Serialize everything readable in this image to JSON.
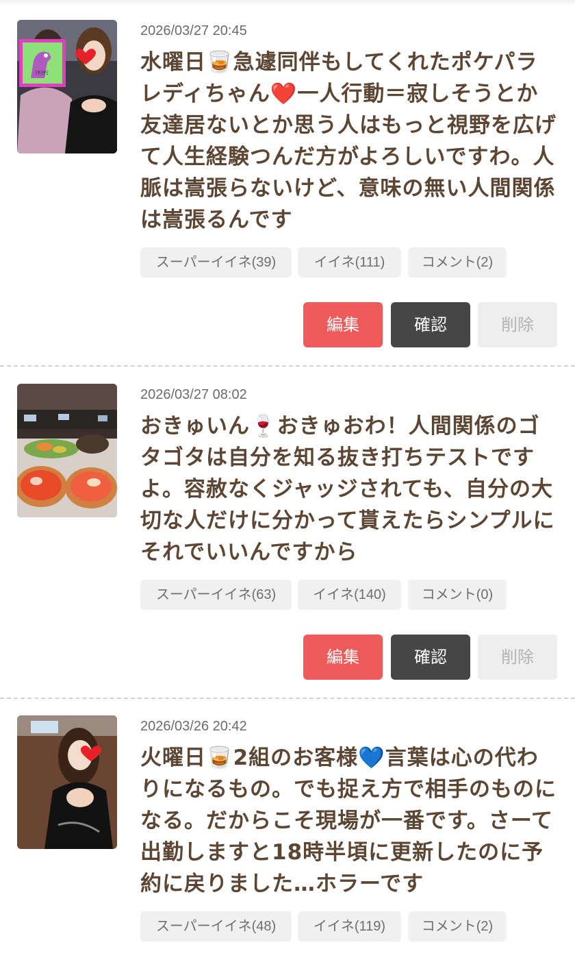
{
  "posts": [
    {
      "date": "2026/03/27 20:45",
      "text": "水曜日🥃急遽同伴もしてくれたポケパラレディちゃん❤️一人行動＝寂しそうとか友達居ないとか思う人はもっと視野を広げて人生経験つんだ方がよろしいですわ。人脈は嵩張らないけど、意味の無い人間関係は嵩張るんです",
      "super_like": "スーパーイイネ(39)",
      "like": "イイネ(111)",
      "comment": "コメント(2)",
      "thumbnail": "photo-two-women",
      "buttons": {
        "edit": "編集",
        "check": "確認",
        "delete": "削除"
      }
    },
    {
      "date": "2026/03/27 08:02",
      "text": "おきゅいん🍷おきゅおわ！人間関係のゴタゴタは自分を知る抜き打ちテストですよ。容赦なくジャッジされても、自分の大切な人だけに分かって貰えたらシンプルにそれでいいんですから",
      "super_like": "スーパーイイネ(63)",
      "like": "イイネ(140)",
      "comment": "コメント(0)",
      "thumbnail": "photo-food-table",
      "buttons": {
        "edit": "編集",
        "check": "確認",
        "delete": "削除"
      }
    },
    {
      "date": "2026/03/26 20:42",
      "text": "火曜日🥃2組のお客様💙言葉は心の代わりになるもの。でも捉え方で相手のものになる。だからこそ現場が一番です。さーて出勤しますと18時半頃に更新したのに予約に戻りました…ホラーです",
      "super_like": "スーパーイイネ(48)",
      "like": "イイネ(119)",
      "comment": "コメント(2)",
      "thumbnail": "photo-woman-black-dress"
    }
  ],
  "colors": {
    "edit_button": "#ef5b5b",
    "check_button": "#464646",
    "delete_button": "#eeeeee",
    "post_text": "#5c4633",
    "pill_background": "#f0f0f0"
  }
}
